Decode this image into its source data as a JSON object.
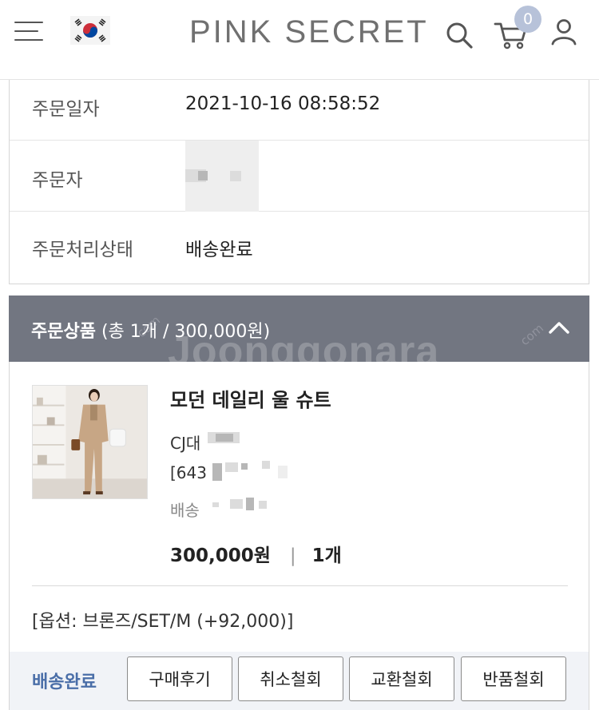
{
  "header": {
    "logo": "PINK SECRET",
    "cart_count": "0"
  },
  "order_info": {
    "rows": [
      {
        "label": "주문일자",
        "value": "2021-10-16 08:58:52"
      },
      {
        "label": "주문자",
        "value": ""
      },
      {
        "label": "주문처리상태",
        "value": "배송완료"
      }
    ]
  },
  "order_products": {
    "title_bold": "주문상품",
    "title_detail": " (총 1개 / 300,000원)"
  },
  "product": {
    "name": "모던 데일리 울 슈트",
    "courier": "CJ대",
    "tracking": "[643",
    "shipping_label": "배송",
    "price": "300,000원",
    "separator": "|",
    "quantity": "1개",
    "option": "[옵션: 브론즈/SET/M (+92,000)]"
  },
  "actions": {
    "status": "배송완료",
    "buttons": [
      "구매후기",
      "취소철회",
      "교환철회",
      "반품철회"
    ]
  },
  "watermark": {
    "main": "Joonggonara",
    "small": "com"
  },
  "colors": {
    "order_bar": "#727681",
    "status_blue": "#4a6ea8",
    "action_bg": "#f1f3f7",
    "badge": "#b7c2d9"
  }
}
